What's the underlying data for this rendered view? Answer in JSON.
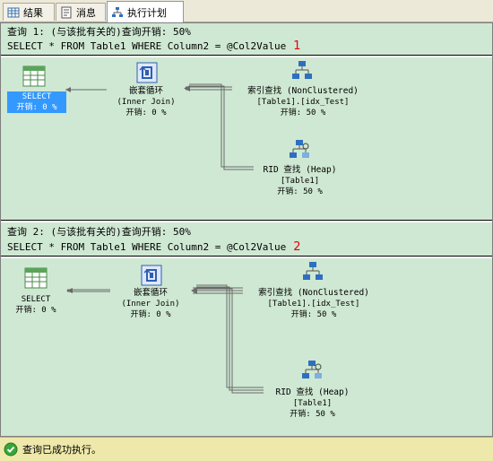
{
  "tabs": [
    {
      "label": "结果",
      "icon": "grid-icon"
    },
    {
      "label": "消息",
      "icon": "message-icon"
    },
    {
      "label": "执行计划",
      "icon": "execution-plan-icon",
      "active": true
    }
  ],
  "plans": [
    {
      "header": "查询 1: (与该批有关的)查询开销: 50%",
      "sql": "SELECT * FROM Table1 WHERE Column2 = @Col2Value",
      "annotation": "1",
      "select": {
        "title": "SELECT",
        "cost": "开销: 0 %",
        "selected": true
      },
      "loop": {
        "title": "嵌套循环",
        "subtitle": "(Inner Join)",
        "cost": "开销: 0 %"
      },
      "seek": {
        "title": "索引查找 (NonClustered)",
        "object": "[Table1].[idx_Test]",
        "cost": "开销: 50 %"
      },
      "rid": {
        "title": "RID 查找 (Heap)",
        "object": "[Table1]",
        "cost": "开销: 50 %"
      }
    },
    {
      "header": "查询 2: (与该批有关的)查询开销: 50%",
      "sql": "SELECT * FROM Table1 WHERE Column2 = @Col2Value",
      "annotation": "2",
      "select": {
        "title": "SELECT",
        "cost": "开销: 0 %",
        "selected": false
      },
      "loop": {
        "title": "嵌套循环",
        "subtitle": "(Inner Join)",
        "cost": "开销: 0 %"
      },
      "seek": {
        "title": "索引查找 (NonClustered)",
        "object": "[Table1].[idx_Test]",
        "cost": "开销: 50 %"
      },
      "rid": {
        "title": "RID 查找 (Heap)",
        "object": "[Table1]",
        "cost": "开销: 50 %"
      }
    }
  ],
  "status": {
    "text": "查询已成功执行。",
    "icon": "success-check-icon"
  },
  "colors": {
    "background": "#cfe8d3",
    "selection": "#3399ff",
    "status_bar": "#eee8aa",
    "annotation": "#e00000"
  }
}
